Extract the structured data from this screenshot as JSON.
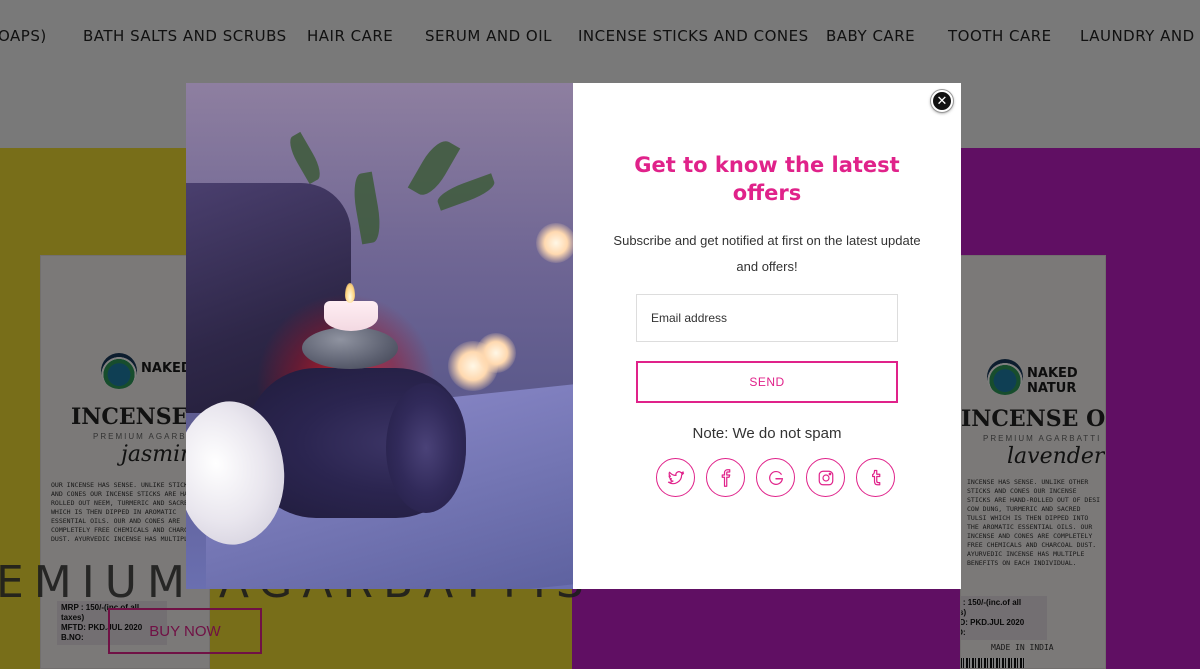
{
  "nav": {
    "items": [
      "OAPS)",
      "BATH SALTS AND SCRUBS",
      "HAIR CARE",
      "SERUM AND OIL",
      "INCENSE STICKS AND CONES",
      "BABY CARE",
      "TOOTH CARE",
      "LAUNDRY AND DI"
    ]
  },
  "background": {
    "left_product": {
      "brand": "NAKED",
      "title": "INCENSE C",
      "subtitle": "PREMIUM AGARB",
      "scent": "jasmin",
      "description": "OUR INCENSE HAS SENSE. UNLIKE STICKS AND CONES OUR INCENSE STICKS ARE HAND-ROLLED OUT NEEM, TURMERIC AND SACRED WHICH IS THEN DIPPED IN AROMATIC ESSENTIAL OILS. OUR AND CONES ARE COMPLETELY FREE CHEMICALS AND CHARCOAL DUST. AYURVEDIC INCENSE HAS MULTIPLE",
      "mrp": "MRP : 150/-(inc.of all taxes)\nMFTD: PKD.JUL 2020\nB.NO:"
    },
    "right_product": {
      "brand": "NAKED NATUR",
      "title": "INCENSE OF L",
      "subtitle": "PREMIUM AGARBATTI",
      "scent": "lavender",
      "description": "INCENSE HAS SENSE. UNLIKE OTHER STICKS AND CONES OUR INCENSE STICKS ARE HAND-ROLLED OUT OF DESI COW DUNG, TURMERIC AND SACRED TULSI WHICH IS THEN DIPPED INTO THE AROMATIC ESSENTIAL OILS. OUR INCENSE AND CONES ARE COMPLETELY FREE CHEMICALS AND CHARCOAL DUST. AYURVEDIC INCENSE HAS MULTIPLE BENEFITS ON EACH INDIVIDUAL.",
      "mrp": "MRP : 150/-(inc.of all taxes)\nMFTD: PKD.JUL 2020\nB.NO:",
      "made_in": "MADE IN INDIA"
    },
    "big_text": "EMIUM AGARBATTIS",
    "buy_now": "BUY NOW"
  },
  "popup": {
    "close_symbol": "✕",
    "heading": "Get to know the latest offers",
    "description": "Subscribe and get notified at first on the latest update and offers!",
    "email_placeholder": "Email address",
    "send_label": "SEND",
    "note": "Note: We do not spam",
    "accent_color": "#e0228a",
    "socials": [
      "twitter-icon",
      "facebook-icon",
      "google-icon",
      "instagram-icon",
      "tumblr-icon"
    ]
  }
}
